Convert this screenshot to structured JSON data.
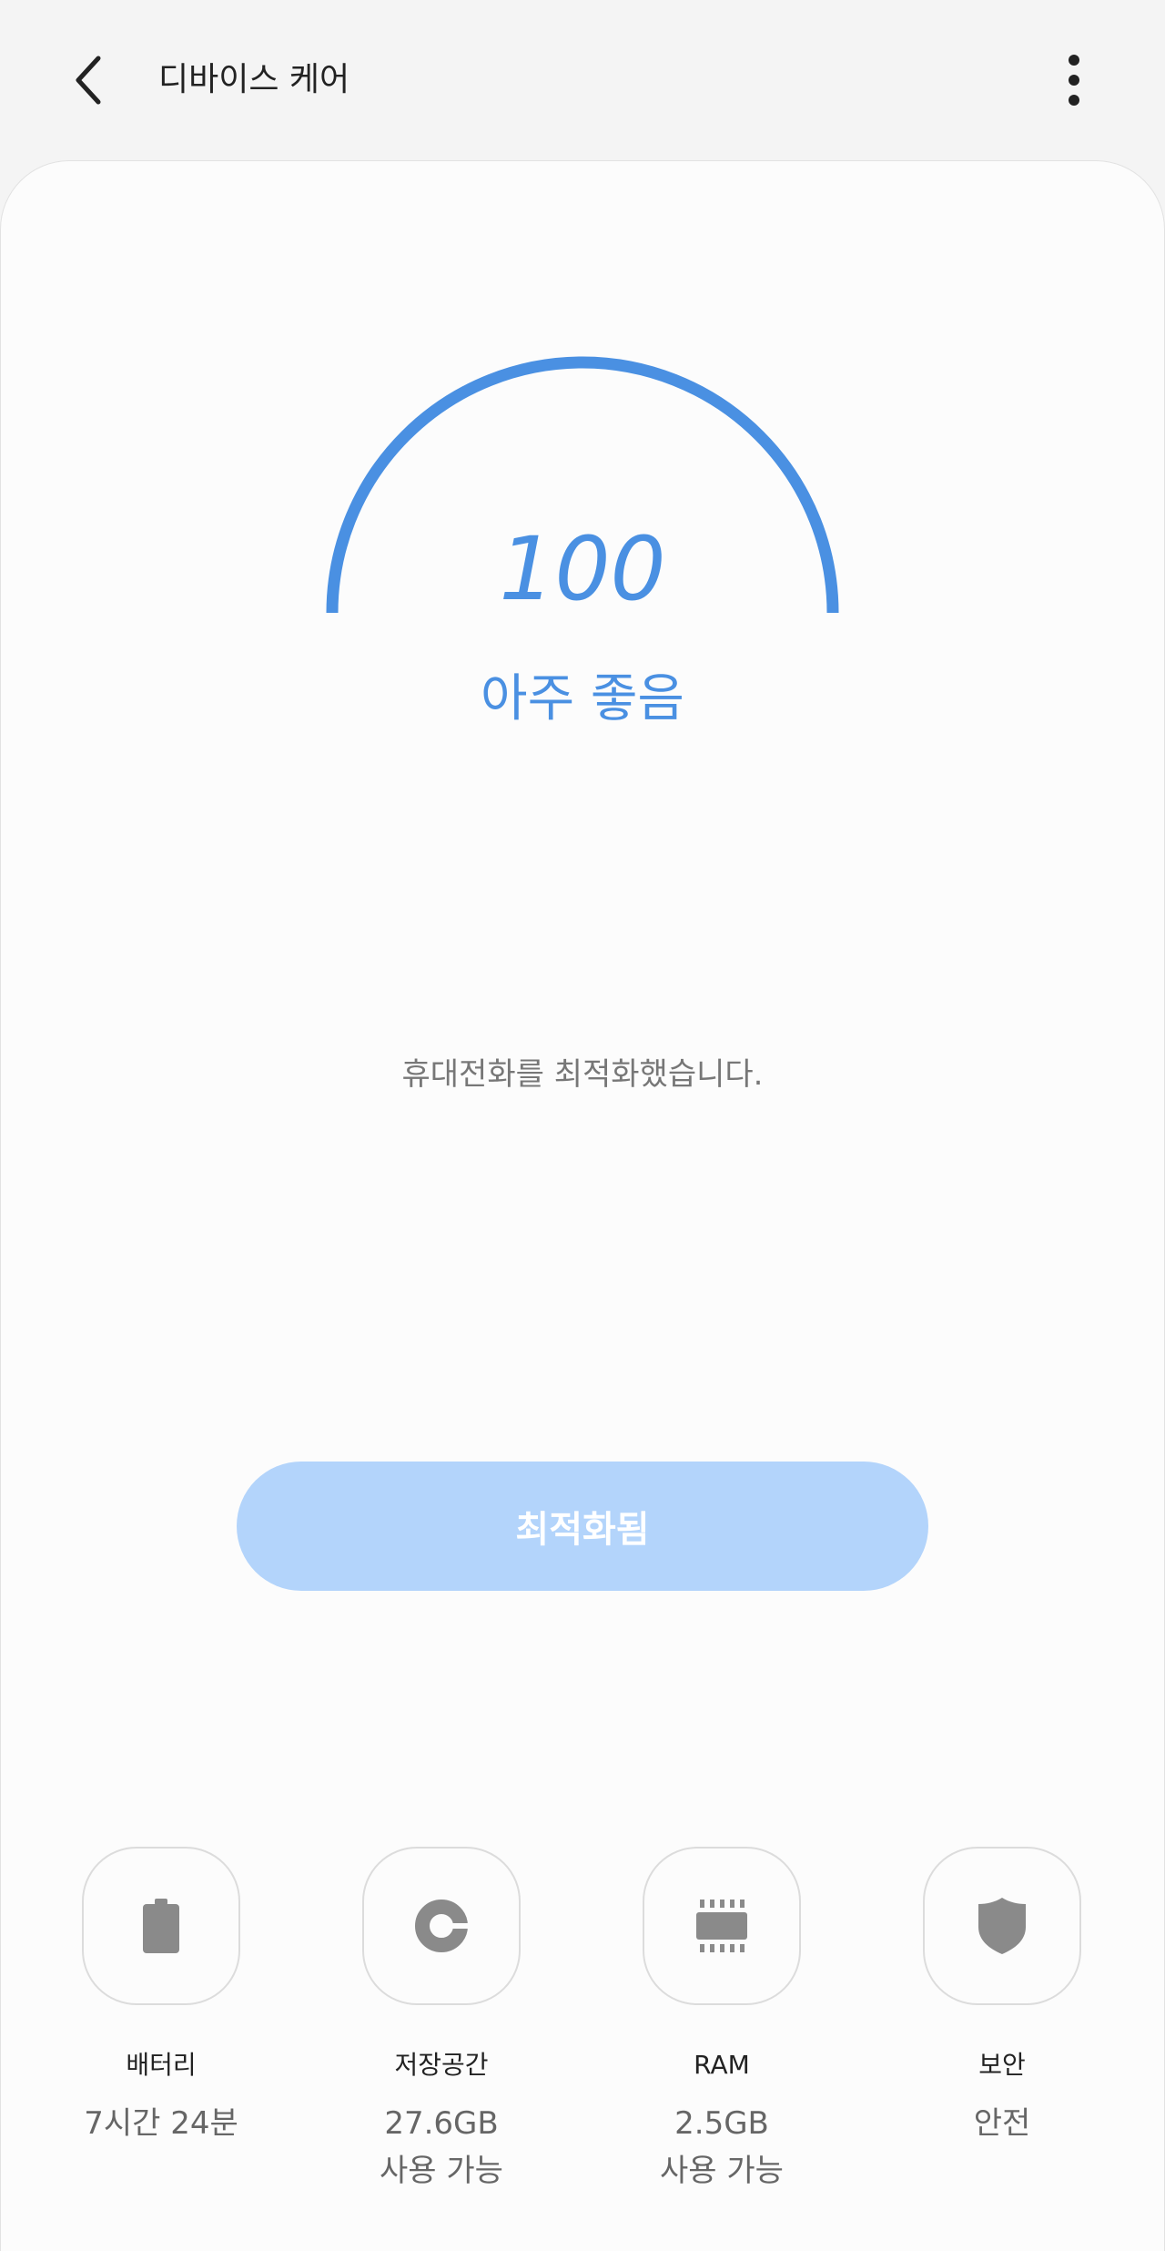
{
  "header": {
    "title": "디바이스 케어",
    "back_icon": "back-arrow-icon",
    "more_icon": "more-vertical-icon"
  },
  "score": {
    "value": "100",
    "status": "아주 좋음",
    "level": 1.0,
    "color": "#4a90e2"
  },
  "message": "휴대전화를 최적화했습니다.",
  "optimize_button": {
    "label": "최적화됨",
    "color": "#b3d4fb"
  },
  "tiles": [
    {
      "icon": "battery-icon",
      "label": "배터리",
      "value_line1": "7시간 24분",
      "value_line2": ""
    },
    {
      "icon": "storage-icon",
      "label": "저장공간",
      "value_line1": "27.6GB",
      "value_line2": "사용 가능"
    },
    {
      "icon": "memory-chip-icon",
      "label": "RAM",
      "value_line1": "2.5GB",
      "value_line2": "사용 가능"
    },
    {
      "icon": "shield-icon",
      "label": "보안",
      "value_line1": "안전",
      "value_line2": ""
    }
  ]
}
